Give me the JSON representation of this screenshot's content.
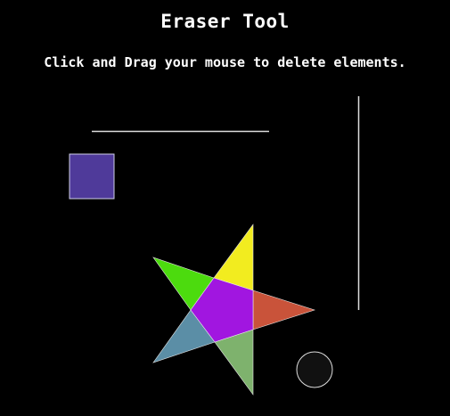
{
  "header": {
    "title": "Eraser Tool",
    "instructions": "Click and Drag your mouse to delete elements."
  },
  "colors": {
    "background": "#000000",
    "text": "#ffffff",
    "line": "#dddddd",
    "square": "#4f3a9a",
    "star_top": "#f2ec1f",
    "star_right": "#c9533a",
    "star_bottom": "#7eb26d",
    "star_left": "#5b8ea6",
    "star_upper_left": "#4cdb0e",
    "star_center": "#a116e0",
    "circle": "#111111"
  }
}
